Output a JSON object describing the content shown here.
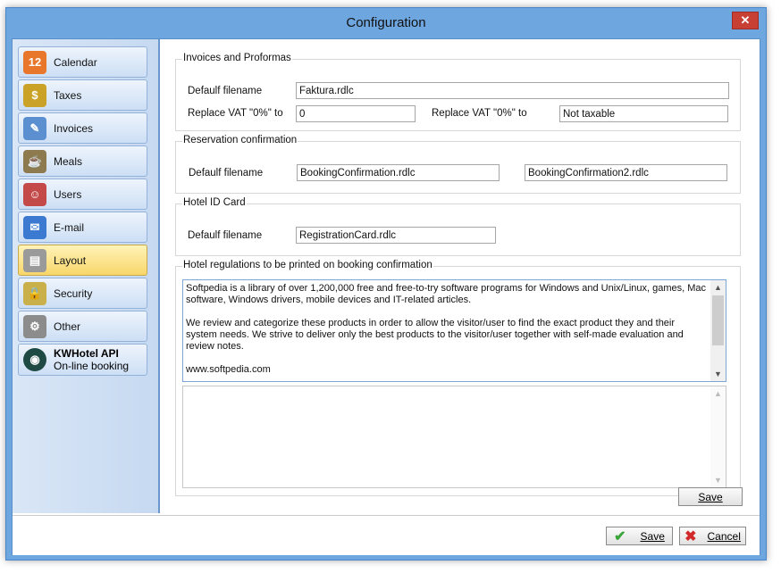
{
  "window": {
    "title": "Configuration",
    "close_glyph": "✕"
  },
  "sidebar": {
    "items": [
      {
        "label": "Calendar",
        "icon": "calendar-icon",
        "glyph": "12"
      },
      {
        "label": "Taxes",
        "icon": "coins-icon",
        "glyph": "$"
      },
      {
        "label": "Invoices",
        "icon": "invoice-icon",
        "glyph": "✎"
      },
      {
        "label": "Meals",
        "icon": "meals-icon",
        "glyph": "☕"
      },
      {
        "label": "Users",
        "icon": "users-icon",
        "glyph": "☺"
      },
      {
        "label": "E-mail",
        "icon": "email-icon",
        "glyph": "✉"
      },
      {
        "label": "Layout",
        "icon": "layout-icon",
        "glyph": "▤",
        "active": true
      },
      {
        "label": "Security",
        "icon": "lock-icon",
        "glyph": "🔒"
      },
      {
        "label": "Other",
        "icon": "gears-icon",
        "glyph": "⚙"
      }
    ],
    "api": {
      "title": "KWHotel API",
      "subtitle": "On-line booking",
      "icon": "globe-icon"
    }
  },
  "invoices": {
    "legend": "Invoices and Proformas",
    "default_label": "Defaulf filename",
    "default_value": "Faktura.rdlc",
    "vat_label1": "Replace VAT \"0%\" to",
    "vat_value1": "0",
    "vat_label2": "Replace VAT \"0%\" to",
    "vat_value2": "Not taxable"
  },
  "reservation": {
    "legend": "Reservation confirmation",
    "default_label": "Defaulf filename",
    "value1": "BookingConfirmation.rdlc",
    "value2": "BookingConfirmation2.rdlc"
  },
  "hotel_id": {
    "legend": "Hotel ID Card",
    "default_label": "Defaulf filename",
    "value": "RegistrationCard.rdlc"
  },
  "regulations": {
    "legend": "Hotel regulations to be printed on booking confirmation",
    "text": "Softpedia is a library of over 1,200,000 free and free-to-try software programs for Windows and Unix/Linux, games, Mac software, Windows drivers, mobile devices and IT-related articles.\n\nWe review and categorize these products in order to allow the visitor/user to find the exact product they and their system needs. We strive to deliver only the best products to the visitor/user together with self-made evaluation and review notes.\n\nwww.softpedia.com",
    "text2": "",
    "save_label": "Save"
  },
  "footer": {
    "save_label": "Save",
    "cancel_label": "Cancel"
  },
  "colors": {
    "active_item": "#f8d66a",
    "sidebar": "#c6d9f1",
    "close": "#c83f34"
  }
}
